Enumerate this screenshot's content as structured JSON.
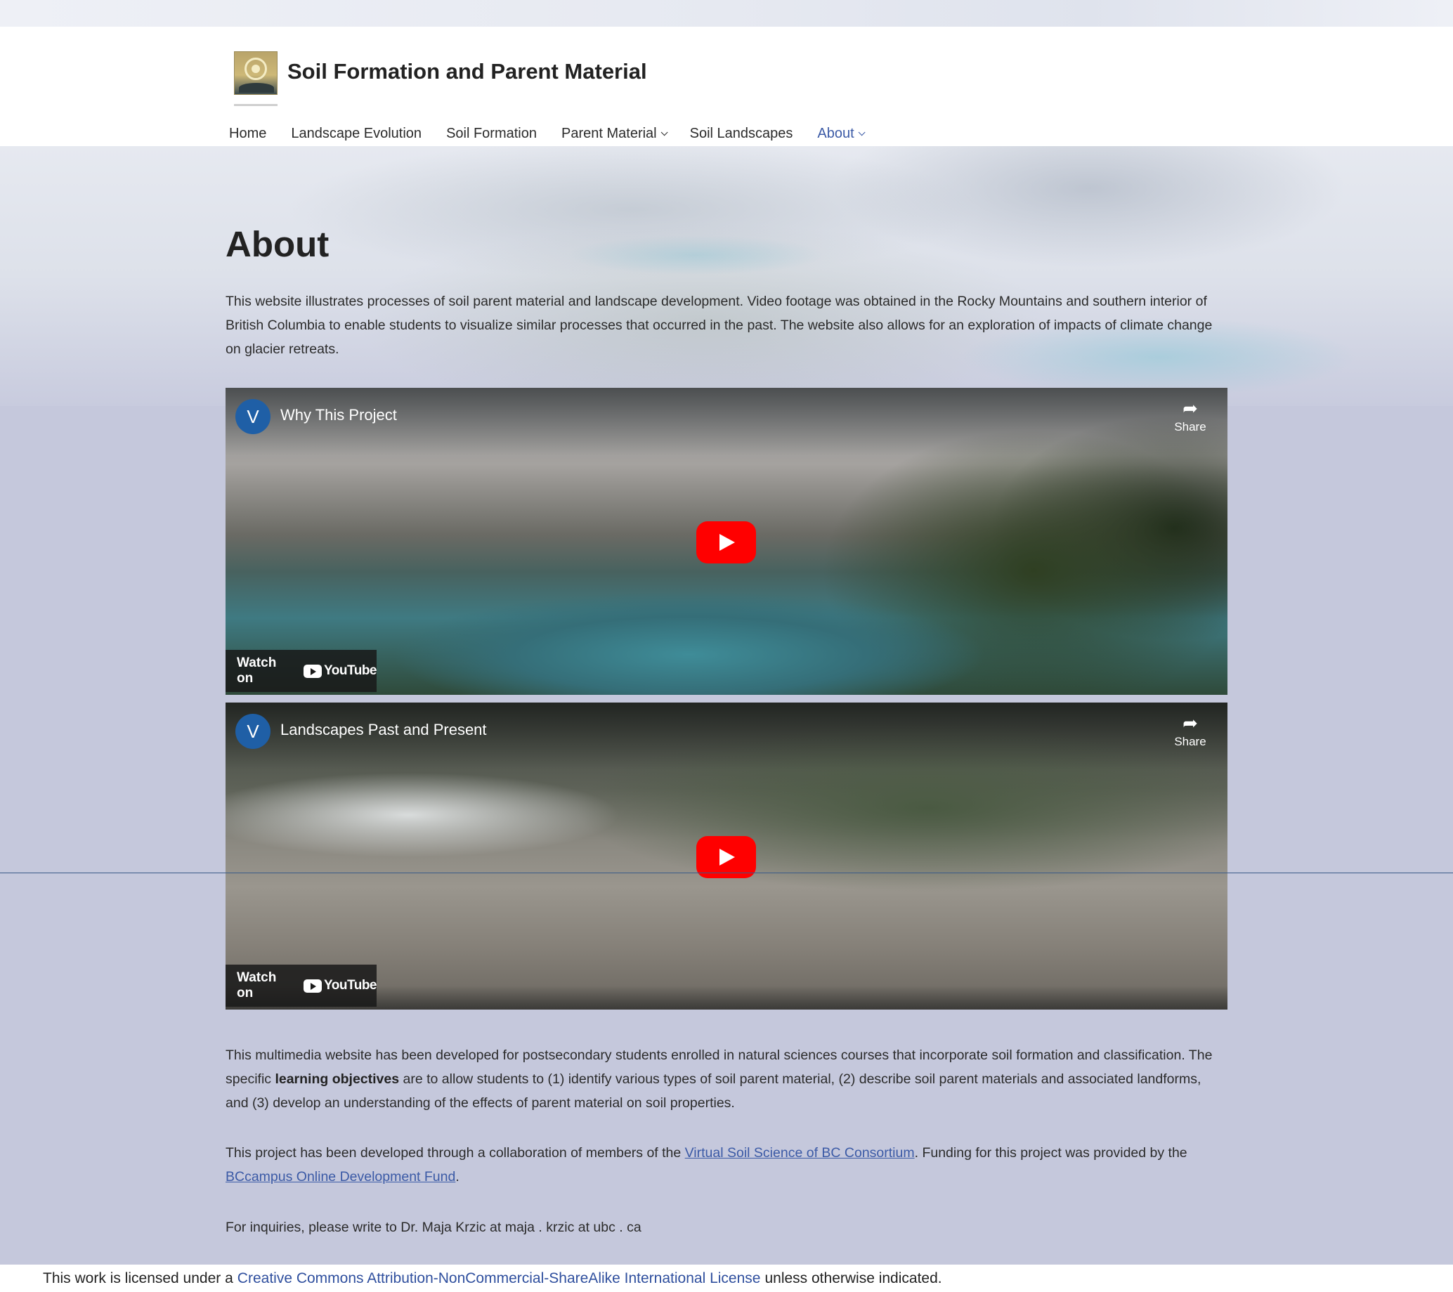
{
  "site": {
    "title": "Soil Formation and Parent Material"
  },
  "nav": {
    "items": [
      {
        "label": "Home"
      },
      {
        "label": "Landscape Evolution"
      },
      {
        "label": "Soil Formation"
      },
      {
        "label": "Parent Material"
      },
      {
        "label": "Soil Landscapes"
      },
      {
        "label": "About"
      }
    ]
  },
  "page": {
    "title": "About",
    "intro": "This website illustrates processes of soil parent material and landscape development. Video footage was obtained in the Rocky Mountains and southern interior of British Columbia to enable students to visualize similar processes that occurred in the past. The website also allows for an exploration of impacts of climate change on glacier retreats.",
    "para2_part1": "This multimedia website has been developed for postsecondary students enrolled in natural sciences courses that incorporate soil formation and classification. The specific ",
    "para2_bold": "learning objectives",
    "para2_part2": " are to allow students to (1) identify various types of soil parent material, (2) describe soil parent materials and associated landforms, and (3) develop an understanding of the effects of parent material on soil properties.",
    "para3_part1": "This project has been developed through a collaboration of members of the ",
    "para3_link1": "Virtual Soil Science of BC Consortium",
    "para3_part2": ". Funding for this project was provided by the ",
    "para3_link2": "BCcampus Online Development Fund",
    "para3_part3": ".",
    "inquiries": "For inquiries, please write to Dr. Maja Krzic at maja . krzic at ubc . ca"
  },
  "videos": [
    {
      "avatar": "V",
      "title": "Why This Project",
      "share": "Share",
      "watch_on": "Watch on",
      "yt": "YouTube"
    },
    {
      "avatar": "V",
      "title": "Landscapes Past and Present",
      "share": "Share",
      "watch_on": "Watch on",
      "yt": "YouTube"
    }
  ],
  "footer": {
    "prefix": "This work is licensed under a ",
    "link": "Creative Commons Attribution-NonCommercial-ShareAlike International License",
    "suffix": " unless otherwise indicated."
  },
  "colors": {
    "accent": "#3b5aa6",
    "play": "#ff0000",
    "page_bg": "#c5c8dc"
  }
}
